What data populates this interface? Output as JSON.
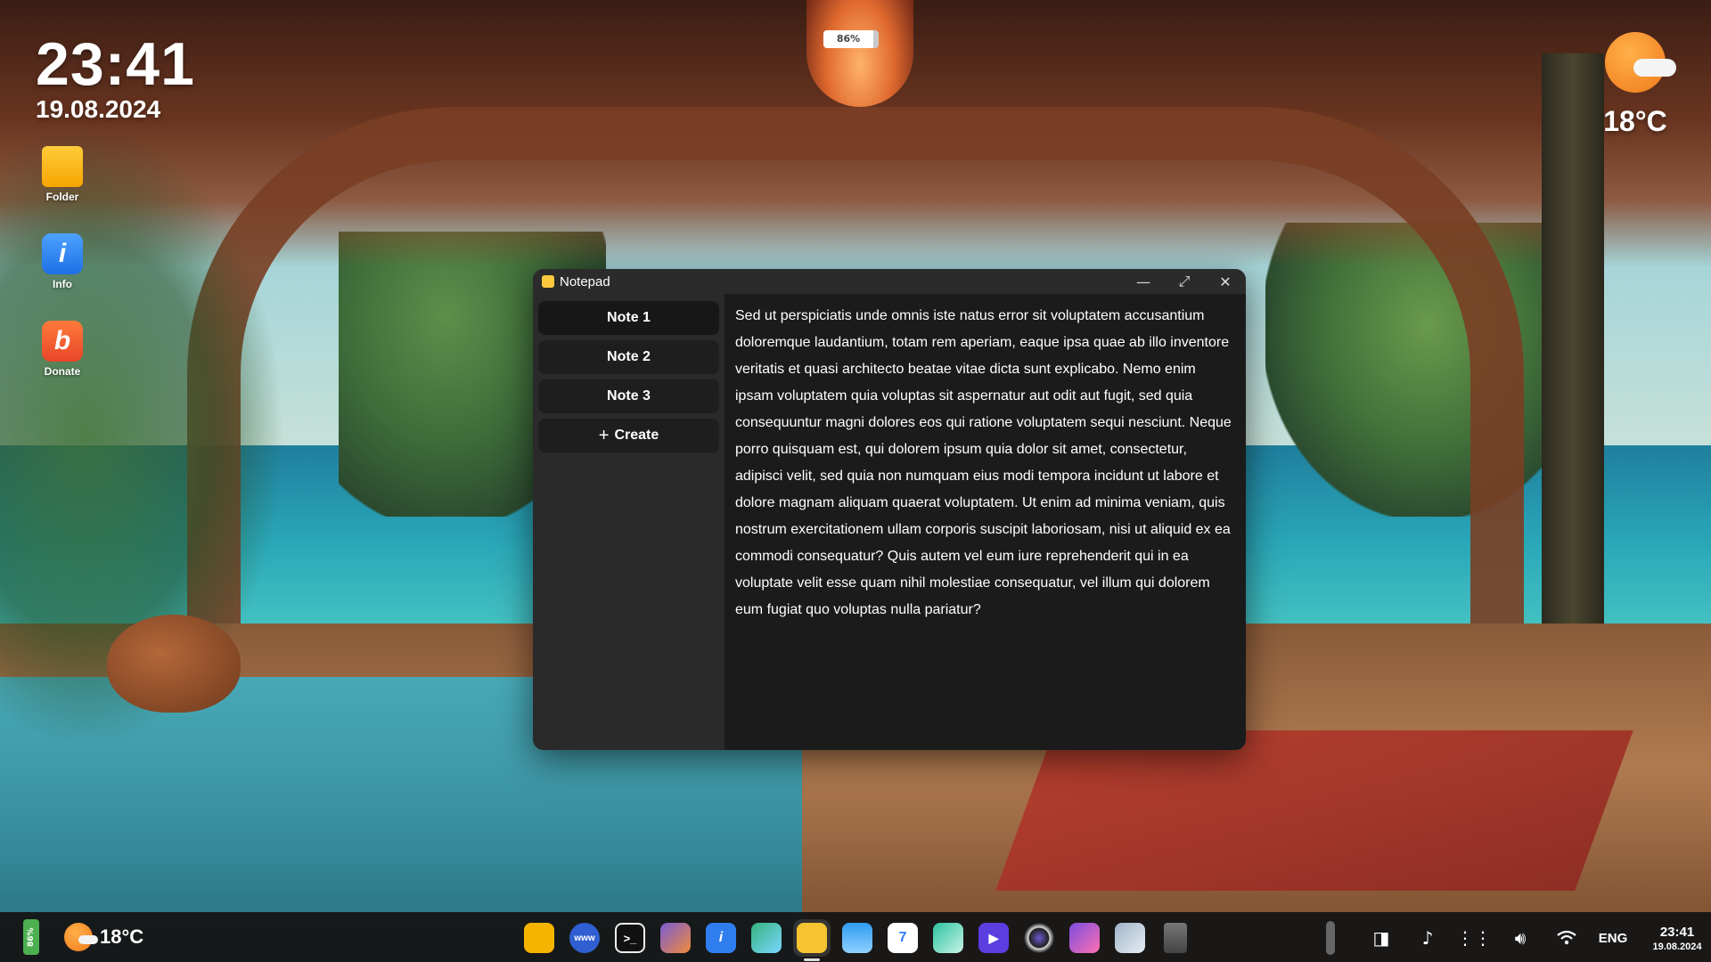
{
  "desktop": {
    "time": "23:41",
    "date": "19.08.2024",
    "battery_indicator": "86%",
    "weather": {
      "temperature": "18°C",
      "icon": "partly-cloudy-icon"
    },
    "icons": [
      {
        "label": "Folder",
        "icon": "folder-icon"
      },
      {
        "label": "Info",
        "icon": "info-icon"
      },
      {
        "label": "Donate",
        "icon": "donate-icon"
      }
    ]
  },
  "window": {
    "title": "Notepad",
    "title_icon": "notepad-icon",
    "controls": {
      "minimize": "—",
      "maximize": "⤢",
      "close": "✕"
    },
    "notes": [
      {
        "label": "Note 1",
        "active": true
      },
      {
        "label": "Note 2",
        "active": false
      },
      {
        "label": "Note 3",
        "active": false
      }
    ],
    "create_label": "Create",
    "content": "Sed ut perspiciatis unde omnis iste natus error sit voluptatem accusantium doloremque laudantium, totam rem aperiam, eaque ipsa quae ab illo inventore veritatis et quasi architecto beatae vitae dicta sunt explicabo. Nemo enim ipsam voluptatem quia voluptas sit aspernatur aut odit aut fugit, sed quia consequuntur magni dolores eos qui ratione voluptatem sequi nesciunt. Neque porro quisquam est, qui dolorem ipsum quia dolor sit amet, consectetur, adipisci velit, sed quia non numquam eius modi tempora incidunt ut labore et dolore magnam aliquam quaerat voluptatem. Ut enim ad minima veniam, quis nostrum exercitationem ullam corporis suscipit laboriosam, nisi ut aliquid ex ea commodi consequatur? Quis autem vel eum iure reprehenderit qui in ea voluptate velit esse quam nihil molestiae consequatur, vel illum qui dolorem eum fugiat quo voluptas nulla pariatur?"
  },
  "taskbar": {
    "battery": "86%",
    "weather_temp": "18°C",
    "dock": [
      {
        "icon": "folder-icon",
        "color": "#f5b400"
      },
      {
        "icon": "browser-icon",
        "color": "#2f5fd0",
        "text": "www"
      },
      {
        "icon": "terminal-icon",
        "color": "#111111",
        "text": ">_"
      },
      {
        "icon": "calculator-icon",
        "color": "#7a5cd6"
      },
      {
        "icon": "info-icon",
        "color": "#2f7ef0",
        "text": "i"
      },
      {
        "icon": "tic-tac-toe-icon",
        "color": "#36b37e"
      },
      {
        "icon": "notepad-icon",
        "color": "#f5c430",
        "active": true
      },
      {
        "icon": "weather-icon",
        "color": "#2f9bf0"
      },
      {
        "icon": "calendar-icon",
        "color": "#ffffff",
        "text": "7"
      },
      {
        "icon": "photos-icon",
        "color": "#2cc3a0"
      },
      {
        "icon": "video-player-icon",
        "color": "#5a3ee0",
        "text": "▶"
      },
      {
        "icon": "camera-icon",
        "color": "#222222"
      },
      {
        "icon": "paint-icon",
        "color": "#7b4de0"
      },
      {
        "icon": "settings-icon",
        "color": "#9fb4c8"
      },
      {
        "icon": "trash-icon",
        "color": "#666666"
      }
    ],
    "language": "ENG",
    "time": "23:41",
    "date": "19.08.2024"
  }
}
